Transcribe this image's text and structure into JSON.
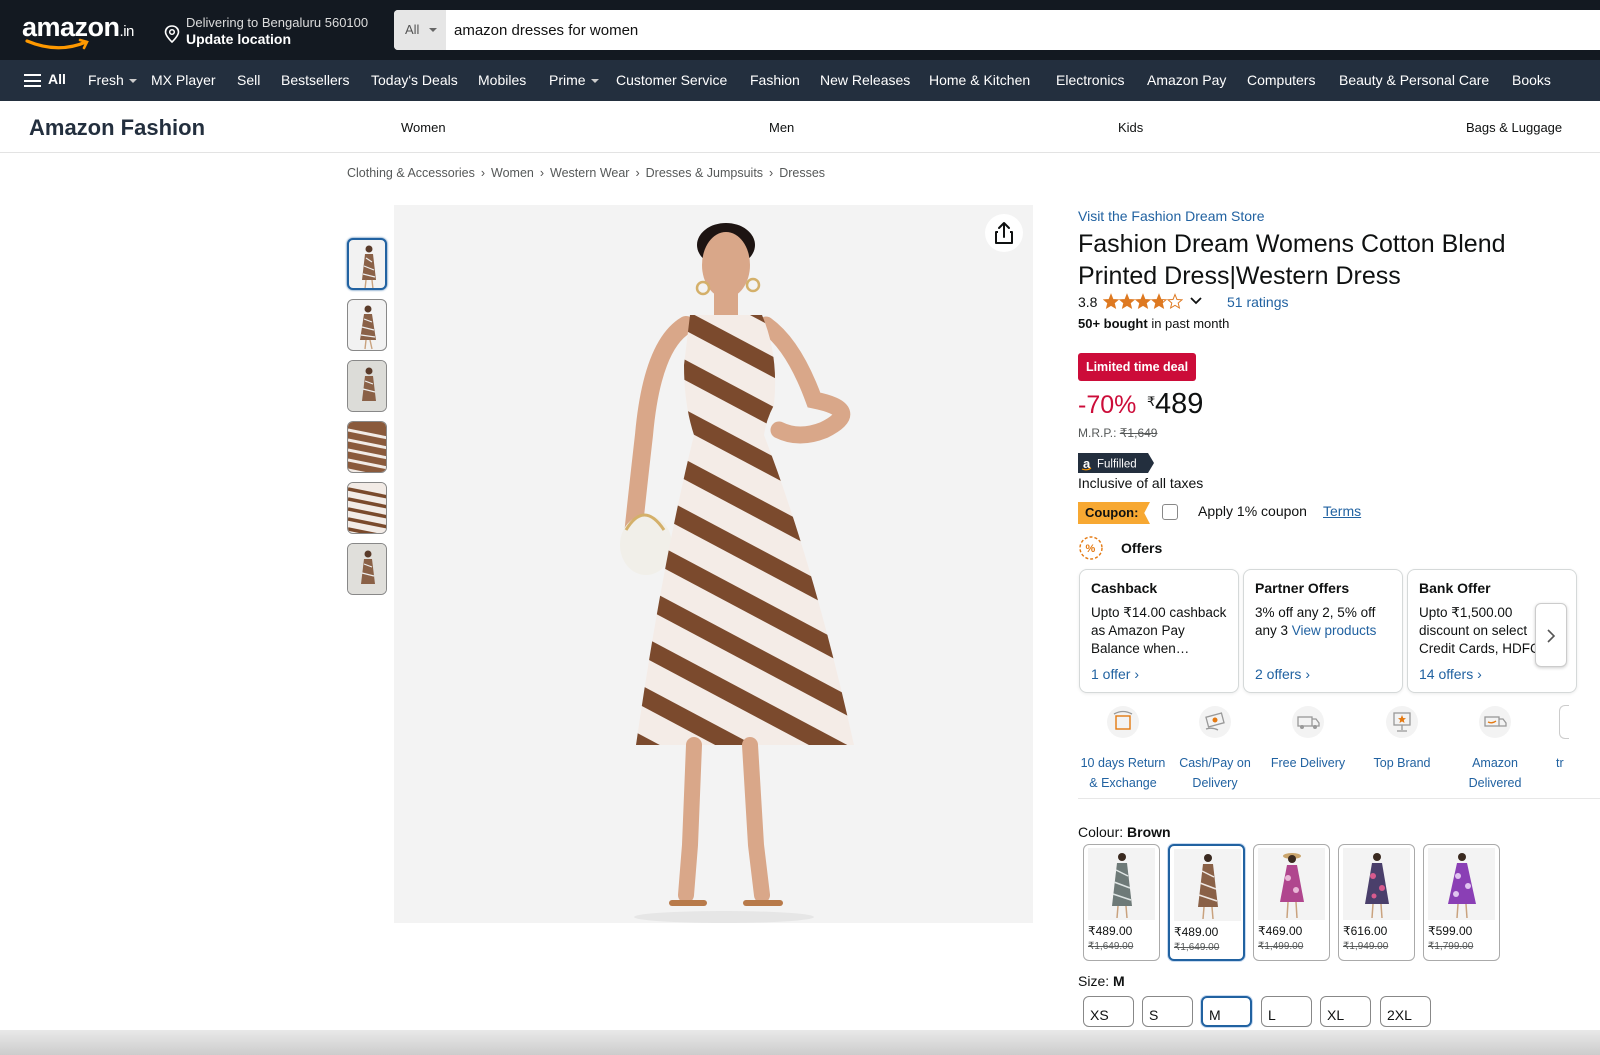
{
  "header": {
    "logo_text": "amazon",
    "logo_suffix": ".in",
    "deliver_line1": "Delivering to Bengaluru 560100",
    "deliver_line2": "Update location",
    "search_category": "All",
    "search_query": "amazon dresses for women"
  },
  "nav": {
    "all_label": "All",
    "items": [
      "Fresh",
      "MX Player",
      "Sell",
      "Bestsellers",
      "Today's Deals",
      "Mobiles",
      "Prime",
      "Customer Service",
      "Fashion",
      "New Releases",
      "Home & Kitchen",
      "Electronics",
      "Amazon Pay",
      "Computers",
      "Beauty & Personal Care",
      "Books"
    ]
  },
  "fashion_bar": {
    "brand": "Amazon Fashion",
    "items": [
      "Women",
      "Men",
      "Kids",
      "Bags & Luggage"
    ]
  },
  "breadcrumb": [
    "Clothing & Accessories",
    "Women",
    "Western Wear",
    "Dresses & Jumpsuits",
    "Dresses"
  ],
  "product": {
    "store_link": "Visit the Fashion Dream Store",
    "title": "Fashion Dream Womens Cotton Blend Printed Dress|Western Dress",
    "rating": "3.8",
    "rating_value": 3.8,
    "ratings_count": "51 ratings",
    "bought_bold": "50+ bought",
    "bought_rest": " in past month",
    "deal_badge": "Limited time deal",
    "discount": "-70%",
    "currency": "₹",
    "price": "489",
    "mrp_label": "M.R.P.: ",
    "mrp_value": "₹1,649",
    "fulfilled": "Fulfilled",
    "taxes": "Inclusive of all taxes",
    "coupon_badge": "Coupon:",
    "coupon_text": "Apply 1% coupon",
    "coupon_terms": "Terms"
  },
  "offers": {
    "title": "Offers",
    "cards": [
      {
        "title": "Cashback",
        "desc": "Upto ₹14.00 cashback as Amazon Pay Balance when…",
        "link_inline": "",
        "link": "1 offer ›"
      },
      {
        "title": "Partner Offers",
        "desc": "3% off any 2, 5% off any 3 ",
        "link_inline": "View products",
        "link": "2 offers ›"
      },
      {
        "title": "Bank Offer",
        "desc": "Upto ₹1,500.00 discount on select Credit Cards, HDFC",
        "link_inline": "",
        "link": "14 offers ›"
      }
    ]
  },
  "features": [
    "10 days Return & Exchange",
    "Cash/Pay on Delivery",
    "Free Delivery",
    "Top Brand",
    "Amazon Delivered",
    "tr"
  ],
  "colour": {
    "label": "Colour: ",
    "selected": "Brown",
    "swatches": [
      {
        "price": "₹489.00",
        "mrp": "₹1,649.00",
        "selected": false
      },
      {
        "price": "₹489.00",
        "mrp": "₹1,649.00",
        "selected": true
      },
      {
        "price": "₹469.00",
        "mrp": "₹1,499.00",
        "selected": false
      },
      {
        "price": "₹616.00",
        "mrp": "₹1,949.00",
        "selected": false
      },
      {
        "price": "₹599.00",
        "mrp": "₹1,799.00",
        "selected": false
      }
    ]
  },
  "size": {
    "label": "Size: ",
    "selected": "M",
    "options": [
      "XS",
      "S",
      "M",
      "L",
      "XL",
      "2XL"
    ]
  },
  "colors": {
    "header_bg": "#131921",
    "nav_bg": "#232f3e",
    "link": "#2162a1",
    "deal_red": "#cc0c39",
    "star": "#de7921",
    "coupon_orange": "#f7a832"
  }
}
